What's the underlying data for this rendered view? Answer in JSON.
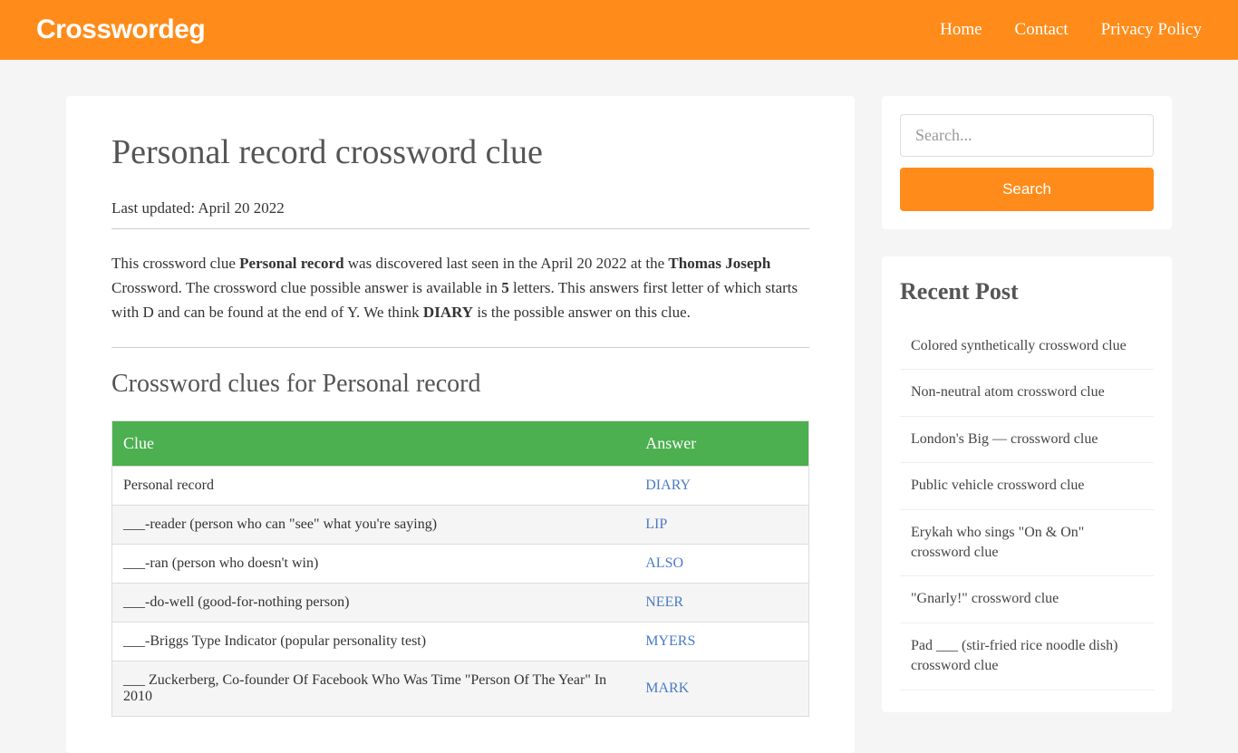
{
  "header": {
    "logo": "Crosswordeg",
    "nav": [
      "Home",
      "Contact",
      "Privacy Policy"
    ]
  },
  "main": {
    "title": "Personal record crossword clue",
    "updated_label": "Last updated: April 20 2022",
    "intro_p1a": "This crossword clue ",
    "intro_b1": "Personal record",
    "intro_p1b": " was discovered last seen in the April 20 2022 at the ",
    "intro_b2": "Thomas Joseph",
    "intro_p1c": " Crossword. The crossword clue possible answer is available in ",
    "intro_b3": "5",
    "intro_p1d": " letters. This answers first letter of which starts with D and can be found at the end of Y. We think ",
    "intro_b4": "DIARY",
    "intro_p1e": " is the possible answer on this clue.",
    "section_title": "Crossword clues for Personal record",
    "table": {
      "head": [
        "Clue",
        "Answer"
      ],
      "rows": [
        {
          "clue": "Personal record",
          "answer": "DIARY"
        },
        {
          "clue": "___-reader (person who can \"see\" what you're saying)",
          "answer": "LIP"
        },
        {
          "clue": "___-ran (person who doesn't win)",
          "answer": "ALSO"
        },
        {
          "clue": "___-do-well (good-for-nothing person)",
          "answer": "NEER"
        },
        {
          "clue": "___-Briggs Type Indicator (popular personality test)",
          "answer": "MYERS"
        },
        {
          "clue": "___ Zuckerberg, Co-founder Of Facebook Who Was Time \"Person Of The Year\" In 2010",
          "answer": "MARK"
        }
      ]
    }
  },
  "sidebar": {
    "search": {
      "placeholder": "Search...",
      "button": "Search"
    },
    "recent_title": "Recent Post",
    "recent_posts": [
      "Colored synthetically crossword clue",
      "Non-neutral atom crossword clue",
      "London's Big — crossword clue",
      "Public vehicle crossword clue",
      "Erykah who sings \"On & On\" crossword clue",
      "\"Gnarly!\" crossword clue",
      "Pad ___ (stir-fried rice noodle dish) crossword clue"
    ]
  }
}
